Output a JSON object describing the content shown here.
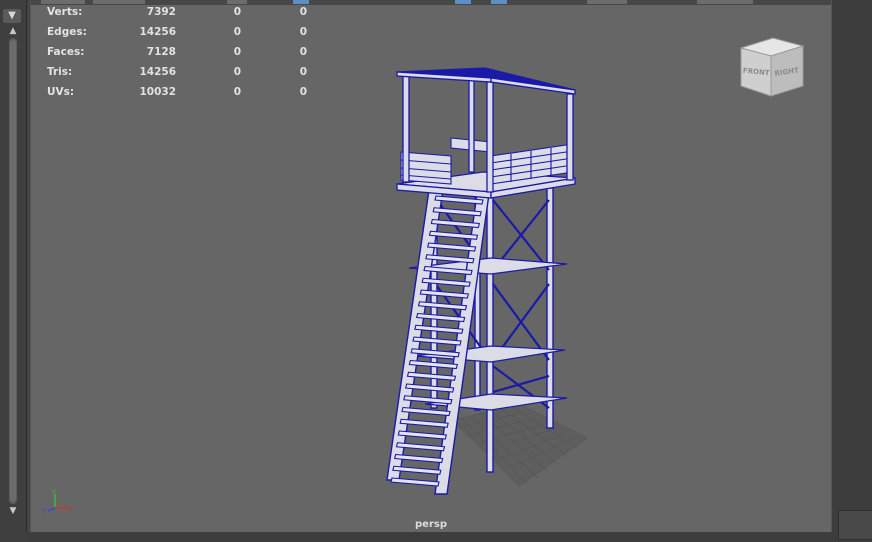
{
  "hud": {
    "rows": [
      {
        "label": "Verts:",
        "v1": "7392",
        "v2": "0",
        "v3": "0"
      },
      {
        "label": "Edges:",
        "v1": "14256",
        "v2": "0",
        "v3": "0"
      },
      {
        "label": "Faces:",
        "v1": "7128",
        "v2": "0",
        "v3": "0"
      },
      {
        "label": "Tris:",
        "v1": "14256",
        "v2": "0",
        "v3": "0"
      },
      {
        "label": "UVs:",
        "v1": "10032",
        "v2": "0",
        "v3": "0"
      }
    ]
  },
  "viewcube": {
    "front": "FRONT",
    "right": "RIGHT"
  },
  "axis": {
    "y": "y",
    "z": "z",
    "x": "x"
  },
  "camera": {
    "name": "persp"
  },
  "colors": {
    "viewport_bg": "#666666",
    "wireframe": "#1a1aa8",
    "wire_fill": "#dcdce6",
    "hud_text": "#e2e2e2",
    "axis_x": "#d03030",
    "axis_y": "#3cb83c",
    "axis_z": "#3050d0"
  }
}
